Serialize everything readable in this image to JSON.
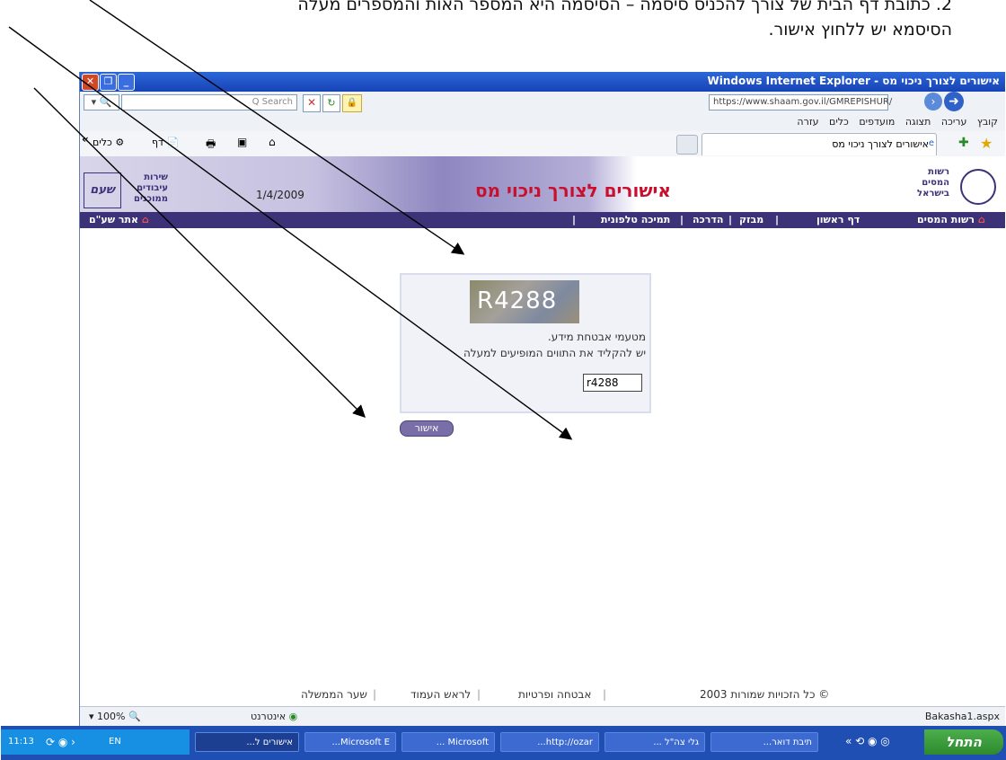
{
  "doc": {
    "line1": "2. כתובת דף הבית של צורך להכניס סיסמה – הסיסמה היא המספר האות והמספרים מעלה",
    "line2": "הסיסמא יש ללחוץ אישור."
  },
  "window": {
    "title": "אישורים לצורך ניכוי מס - Windows Internet Explorer",
    "minimize": "_",
    "restore": "❐",
    "close": "✕"
  },
  "address": {
    "url": "https://www.shaam.gov.il/GMREPISHUR/",
    "search_placeholder": "Q Search"
  },
  "menu": [
    "קובץ",
    "עריכה",
    "תצוגה",
    "מועדפים",
    "כלים",
    "עזרה"
  ],
  "commandbar": {
    "tab_title": "אישורים לצורך ניכוי מס",
    "tools_label": "כלים",
    "page_label": "דף",
    "overflow": "«"
  },
  "site": {
    "org_name": [
      "רשות",
      "המסים",
      "בישראל"
    ],
    "page_title": "אישורים לצורך ניכוי מס",
    "date": "1/4/2009",
    "service_name": [
      "שירות",
      "עיבודים",
      "ממוכנים"
    ],
    "logo_text": "שעם",
    "nav": [
      "רשות המסים",
      "דף ראשון",
      "מבזק",
      "הדרכה",
      "תמיכה טלפונית"
    ],
    "nav_right": "אתר שע\"ם",
    "captcha_text": "R4288",
    "security_text": "מטעמי אבטחת מידע.",
    "instruction_text": "יש להקליד את התווים המופיעים למעלה",
    "input_value": "r4288",
    "submit_label": "אישור"
  },
  "footer": {
    "copyright": "© כל הזכויות שמורות 2003",
    "links": [
      "אבטחה ופרטיות",
      "לראש העמוד",
      "שער הממשלה"
    ]
  },
  "status": {
    "file": "Bakasha1.aspx",
    "zone": "אינטרנט",
    "zoom": "100%"
  },
  "taskbar": {
    "start_label": "התחל",
    "buttons": [
      "תיבת דואר...",
      "גלי צה\"ל ...",
      "http://ozar...",
      "Microsoft ...",
      "Microsoft E...",
      "אישורים ל..."
    ],
    "lang": "EN",
    "time": "11:13"
  },
  "colors": {
    "nav_bg": "#3b3278",
    "title_red": "#c8102e",
    "taskbar_bg": "#1f4fb3",
    "start_bg": "#3c9a3c"
  }
}
